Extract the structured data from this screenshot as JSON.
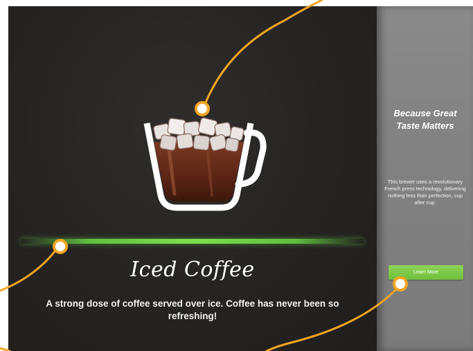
{
  "product": {
    "title": "Iced Coffee",
    "description": "A strong dose of coffee served over ice. Coffee has never been so refreshing!"
  },
  "sidebar": {
    "heading": "Because Great Taste Matters",
    "body": "This brewer uses a revolutionary French press technology, delivering nothing less than perfection, cup after cup.",
    "button_label": "Learn More"
  },
  "colors": {
    "accent_green": "#6fbf3c",
    "callout_orange": "#f5a623",
    "main_bg": "#262422",
    "side_bg": "#838383"
  },
  "icons": {
    "hero": "iced-coffee-mug-icon"
  }
}
